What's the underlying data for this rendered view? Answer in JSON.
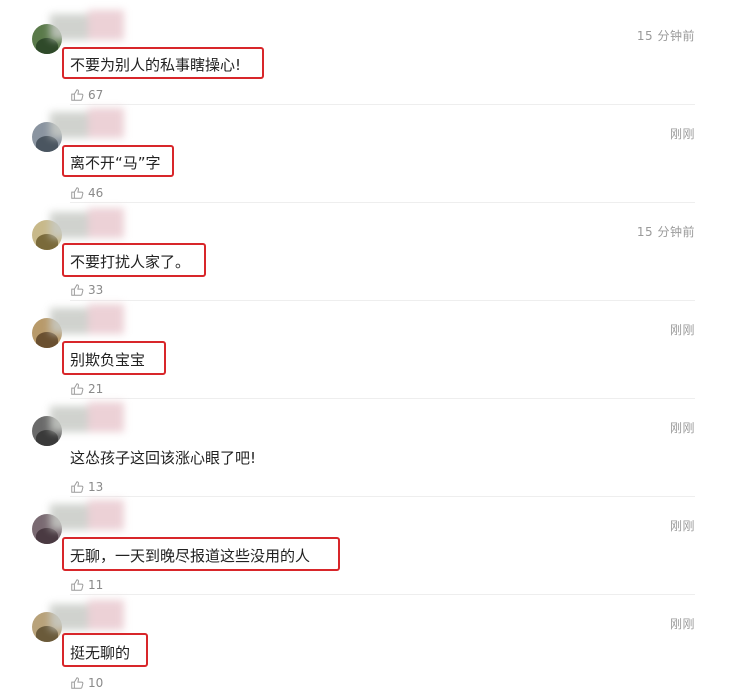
{
  "comments": [
    {
      "time": "15 分钟前",
      "text": "不要为别人的私事瞎操心!",
      "likes": "67",
      "avatar_color": "#5a7a4a",
      "avatar_color2": "#2f4a2a"
    },
    {
      "time": "刚刚",
      "text": "离不开“马”字",
      "likes": "46",
      "avatar_color": "#8a94a0",
      "avatar_color2": "#4a5560"
    },
    {
      "time": "15 分钟前",
      "text": "不要打扰人家了。",
      "likes": "33",
      "avatar_color": "#c8b98a",
      "avatar_color2": "#7a6a3a"
    },
    {
      "time": "刚刚",
      "text": "别欺负宝宝",
      "likes": "21",
      "avatar_color": "#b89a6a",
      "avatar_color2": "#6a5030"
    },
    {
      "time": "刚刚",
      "text": "这怂孩子这回该涨心眼了吧!",
      "likes": "13",
      "avatar_color": "#6a6a6a",
      "avatar_color2": "#3a3a3a"
    },
    {
      "time": "刚刚",
      "text": "无聊，一天到晚尽报道这些没用的人",
      "likes": "11",
      "avatar_color": "#7a6a72",
      "avatar_color2": "#4a3a42"
    },
    {
      "time": "刚刚",
      "text": "挺无聊的",
      "likes": "10",
      "avatar_color": "#b8a27a",
      "avatar_color2": "#6a5a3a"
    }
  ],
  "highlight_color": "#d8262a"
}
